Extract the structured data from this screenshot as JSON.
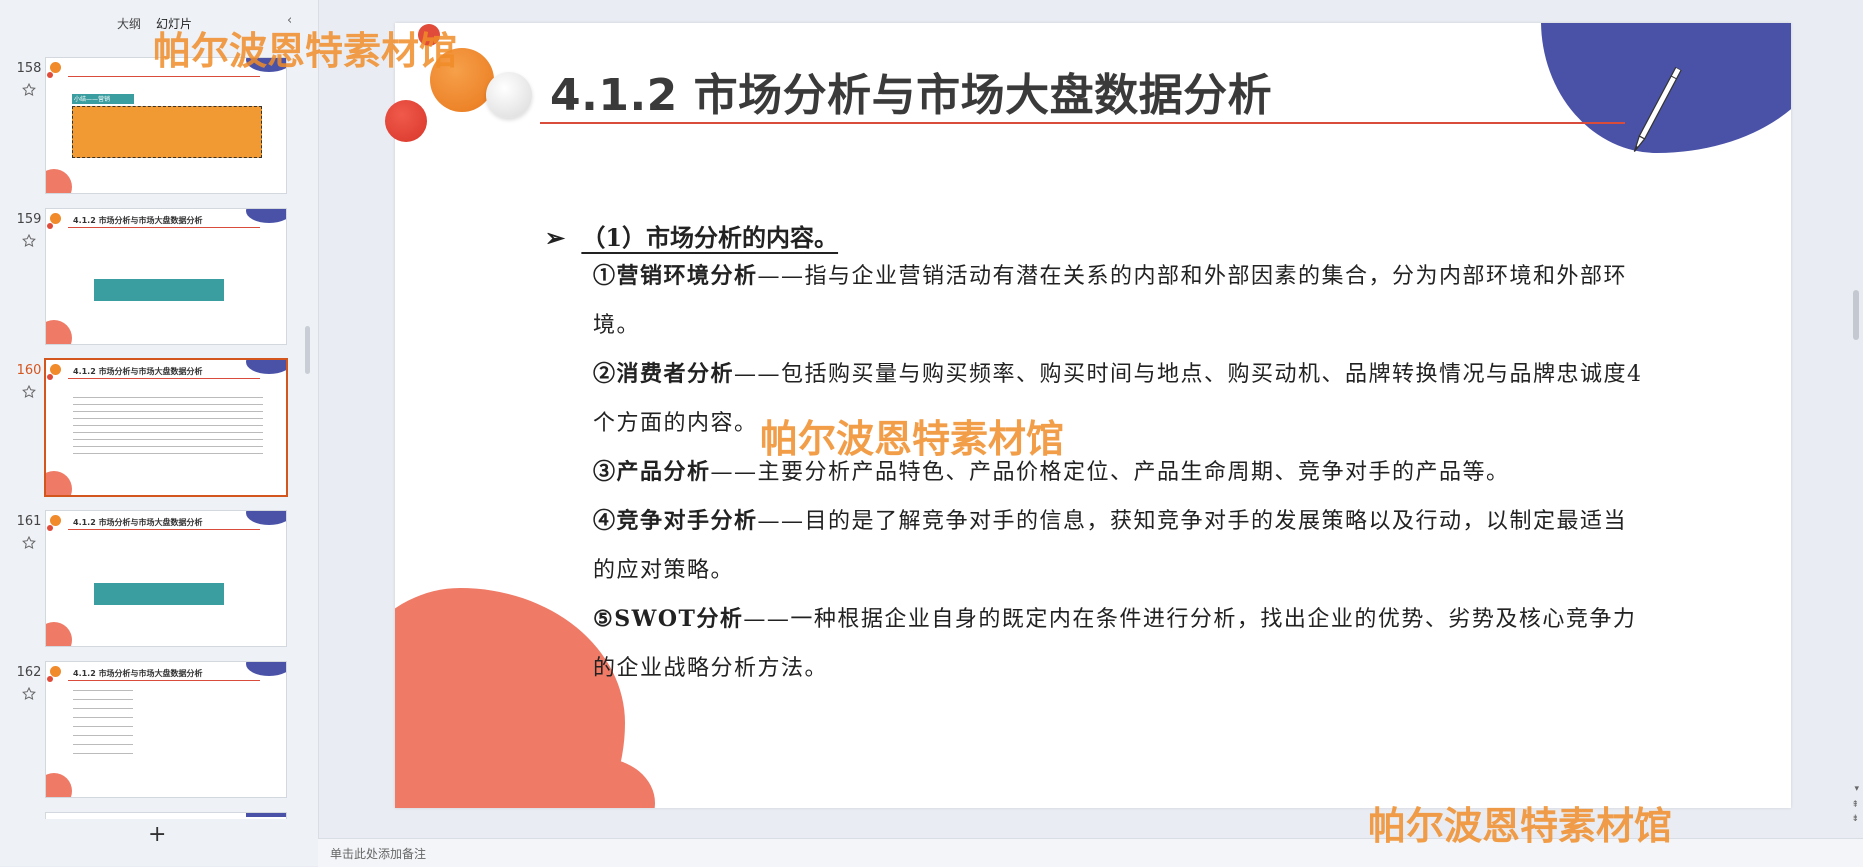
{
  "panel": {
    "tab_outline": "大纲",
    "tab_slides": "幻灯片",
    "collapse_icon": "‹",
    "add_icon": "+"
  },
  "thumbnails": [
    {
      "num": "158",
      "title": "",
      "heading": "小结——营销",
      "type": "orange"
    },
    {
      "num": "159",
      "title": "4.1.2 市场分析与市场大盘数据分析",
      "type": "teal"
    },
    {
      "num": "160",
      "title": "4.1.2 市场分析与市场大盘数据分析",
      "type": "text",
      "selected": true
    },
    {
      "num": "161",
      "title": "4.1.2 市场分析与市场大盘数据分析",
      "type": "teal"
    },
    {
      "num": "162",
      "title": "4.1.2 市场分析与市场大盘数据分析",
      "type": "list"
    }
  ],
  "slide": {
    "title": "4.1.2 市场分析与市场大盘数据分析",
    "subhead": "（1）市场分析的内容。",
    "items": [
      {
        "label": "①营销环境分析",
        "text": "——指与企业营销活动有潜在关系的内部和外部因素的集合，分为内部环境和外部环境。"
      },
      {
        "label": "②消费者分析",
        "text": "——包括购买量与购买频率、购买时间与地点、购买动机、品牌转换情况与品牌忠诚度4个方面的内容。"
      },
      {
        "label": "③产品分析",
        "text": "——主要分析产品特色、产品价格定位、产品生命周期、竞争对手的产品等。"
      },
      {
        "label": "④竞争对手分析",
        "text": "——目的是了解竞争对手的信息，获知竞争对手的发展策略以及行动，以制定最适当的应对策略。"
      },
      {
        "label": "⑤SWOT分析",
        "text": "——一种根据企业自身的既定内在条件进行分析，找出企业的优势、劣势及核心竞争力的企业战略分析方法。"
      }
    ]
  },
  "notes_placeholder": "单击此处添加备注",
  "watermark": "帕尔波恩特素材馆",
  "colors": {
    "accent": "#d4561f",
    "blue": "#4a52a8",
    "coral": "#ef7a66",
    "red_line": "#d94b3a"
  }
}
